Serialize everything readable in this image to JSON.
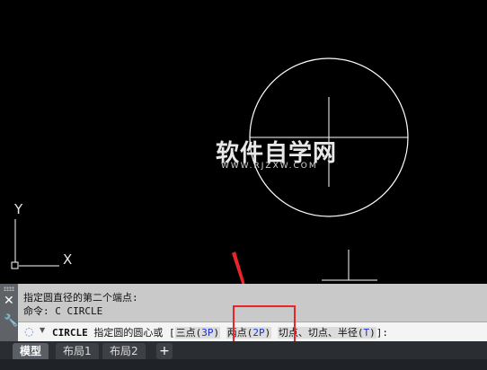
{
  "watermark": {
    "title": "软件自学网",
    "subtitle": "WWW.RJZXW.COM"
  },
  "ucs": {
    "y_label": "Y",
    "x_label": "X"
  },
  "command": {
    "history": [
      "指定圆直径的第二个端点:",
      "命令: C CIRCLE"
    ],
    "prompt_cmd": "CIRCLE",
    "prompt_text": " 指定圆的圆心或 [",
    "opt1_label": "三点(",
    "opt1_key": "3P",
    "opt1_end": ")",
    "opt2_label": "两点(",
    "opt2_key": "2P",
    "opt2_end": ")",
    "opt3_label": "切点、切点、半径(",
    "opt3_key": "T",
    "opt3_end": ")",
    "prompt_close": "]:"
  },
  "tabs": [
    {
      "label": "模型",
      "active": true
    },
    {
      "label": "布局1",
      "active": false
    },
    {
      "label": "布局2",
      "active": false
    }
  ],
  "tab_add": "+",
  "colors": {
    "canvas": "#000000",
    "drawing": "#ffffff",
    "highlight": "#e8262a",
    "keyword": "#1a2fd0"
  }
}
